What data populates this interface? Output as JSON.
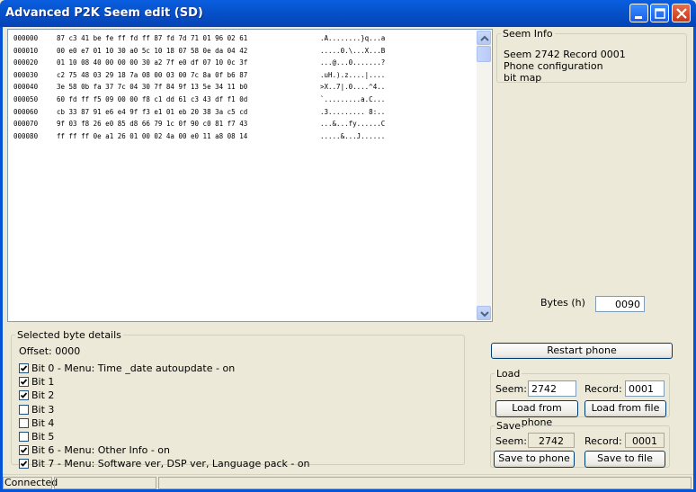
{
  "window": {
    "title": "Advanced P2K Seem edit (SD)"
  },
  "hex": {
    "rows": [
      {
        "offset": "000000",
        "bytes": "87 c3 41 be fe ff fd ff 87 fd 7d 71 01 96 02 61",
        "ascii": ".A........}q...a"
      },
      {
        "offset": "000010",
        "bytes": "00 e0 e7 01 10 30 a0 5c 10 18 07 58 0e da 04 42",
        "ascii": ".....0.\\...X...B"
      },
      {
        "offset": "000020",
        "bytes": "01 10 08 40 00 00 00 30 a2 7f e0 df 07 10 0c 3f",
        "ascii": "...@...0.......?"
      },
      {
        "offset": "000030",
        "bytes": "c2 75 48 03 29 18 7a 08 00 03 00 7c 8a 0f b6 87",
        "ascii": ".uH.).z....|...."
      },
      {
        "offset": "000040",
        "bytes": "3e 58 0b fa 37 7c 04 30 7f 84 9f 13 5e 34 11 b0",
        "ascii": ">X..7|.0....^4.."
      },
      {
        "offset": "000050",
        "bytes": "60 fd ff f5 09 00 00 f8 c1 dd 61 c3 43 df f1 0d",
        "ascii": "`.........a.C..."
      },
      {
        "offset": "000060",
        "bytes": "cb 33 87 91 e6 e4 9f f3 e1 01 eb 20 38 3a c5 cd",
        "ascii": ".3......... 8:.."
      },
      {
        "offset": "000070",
        "bytes": "9f 03 f8 26 e0 85 d8 66 79 1c 0f 90 c0 81 f7 43",
        "ascii": "...&...fy......C"
      },
      {
        "offset": "000080",
        "bytes": "ff ff ff 0e a1 26 01 00 02 4a 00 e0 11 a8 08 14",
        "ascii": ".....&...J......"
      }
    ]
  },
  "seem_info": {
    "legend": "Seem Info",
    "line1": "Seem 2742 Record 0001",
    "line2": "Phone configuration",
    "line3": "bit map"
  },
  "bytes": {
    "label": "Bytes (h)",
    "value": "0090"
  },
  "byte_details": {
    "legend": "Selected byte details",
    "offset_text": "Offset: 0000",
    "bits": [
      {
        "label": "Bit 0 - Menu: Time _date autoupdate - on",
        "checked": true
      },
      {
        "label": "Bit 1",
        "checked": true
      },
      {
        "label": "Bit 2",
        "checked": true
      },
      {
        "label": "Bit 3",
        "checked": false
      },
      {
        "label": "Bit 4",
        "checked": false
      },
      {
        "label": "Bit 5",
        "checked": false
      },
      {
        "label": "Bit 6 - Menu: Other Info - on",
        "checked": true
      },
      {
        "label": "Bit 7 - Menu: Software ver, DSP ver, Language pack - on",
        "checked": true
      }
    ]
  },
  "restart_button": "Restart phone",
  "load": {
    "legend": "Load",
    "seem_label": "Seem:",
    "seem_value": "2742",
    "record_label": "Record:",
    "record_value": "0001",
    "from_phone": "Load from phone",
    "from_file": "Load from file"
  },
  "save": {
    "legend": "Save",
    "seem_label": "Seem:",
    "seem_value": "2742",
    "record_label": "Record:",
    "record_value": "0001",
    "to_phone": "Save to phone",
    "to_file": "Save to file"
  },
  "status": {
    "connection": "Connected"
  }
}
